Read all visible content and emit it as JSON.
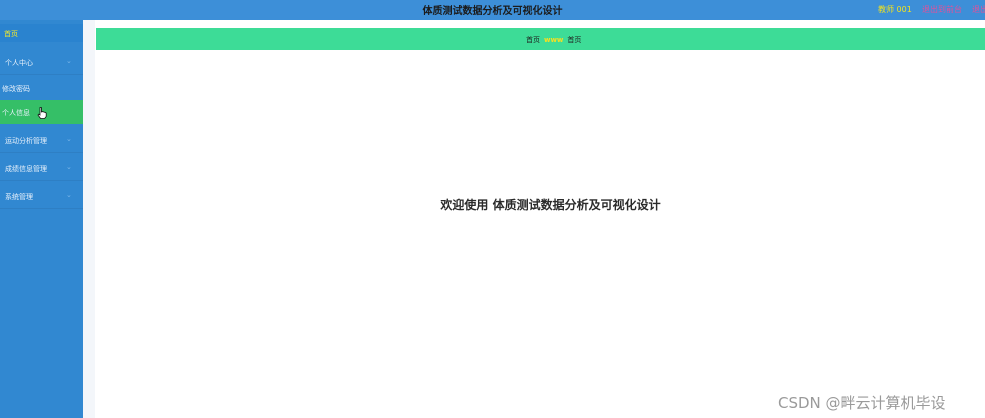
{
  "header": {
    "title": "体质测试数据分析及可视化设计",
    "user": "教师 001",
    "back_label": "退出到前台",
    "logout_label": "退出"
  },
  "sidebar": {
    "home": "首页",
    "items": [
      {
        "label": "个人中心"
      },
      {
        "label": "修改密码"
      },
      {
        "label": "个人信息"
      },
      {
        "label": "运动分析管理"
      },
      {
        "label": "成绩信息管理"
      },
      {
        "label": "系统管理"
      }
    ]
  },
  "breadcrumb": {
    "items": [
      "首页",
      "首页"
    ],
    "separator": "www"
  },
  "main": {
    "welcome": "欢迎使用 体质测试数据分析及可视化设计"
  },
  "watermark": "CSDN @畔云计算机毕设",
  "colors": {
    "topbar": "#3d8fd8",
    "sidebar": "#3188d1",
    "active": "#35bf67",
    "breadcrumb": "#3ddc97",
    "highlight": "#f4ea28"
  }
}
